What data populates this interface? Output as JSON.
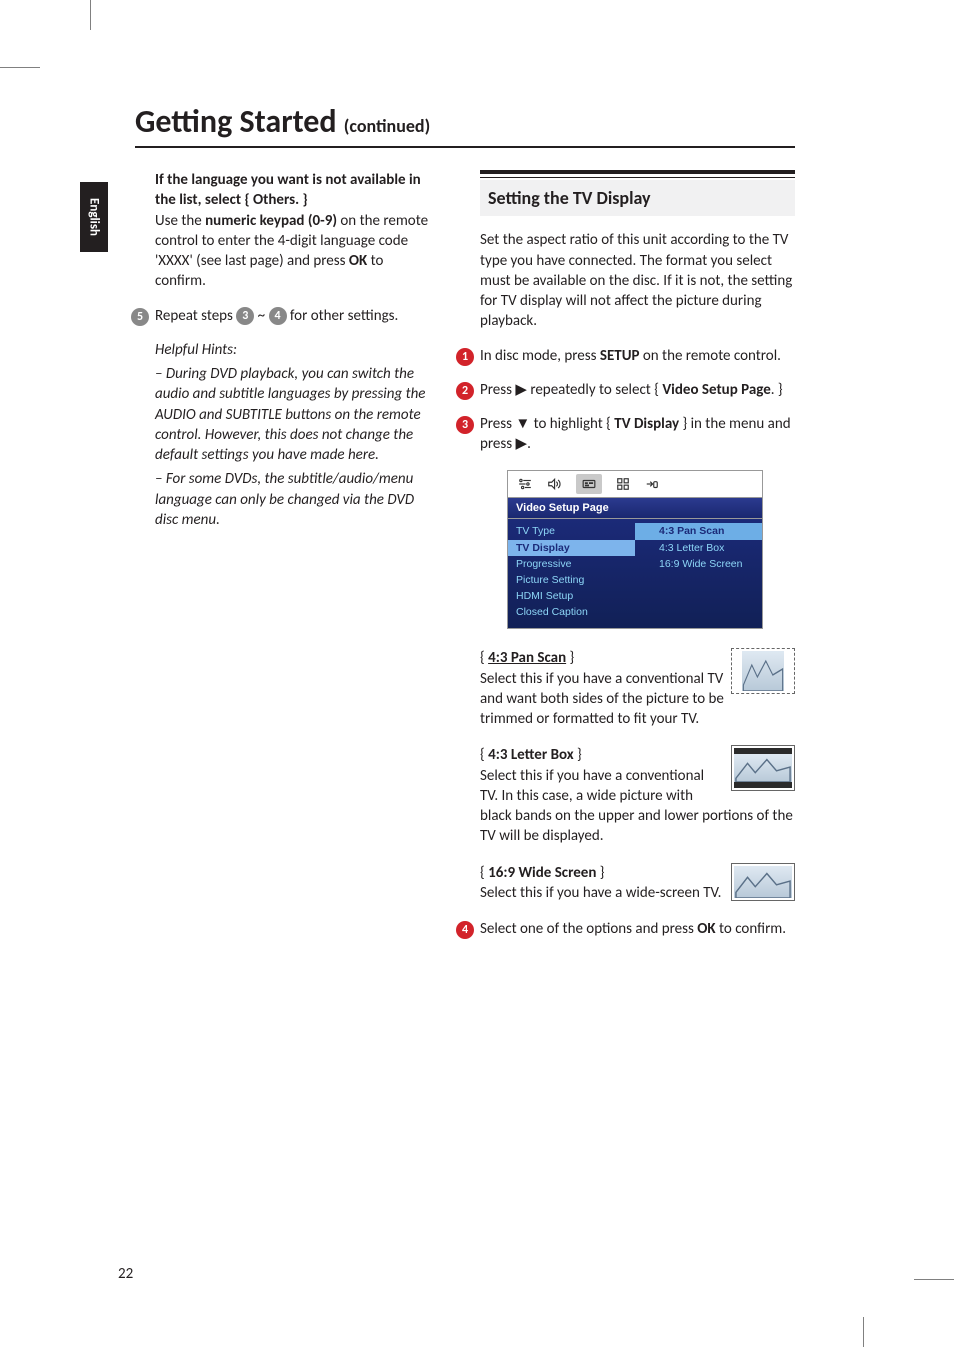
{
  "page": {
    "title": "Getting Started",
    "title_suffix": "(continued)",
    "language_tab": "English",
    "page_number": "22"
  },
  "left": {
    "bold_intro_1": "If the language you want is not available in the list, select { Others. }",
    "intro_2a": "Use the ",
    "intro_2b": "numeric keypad (0-9)",
    "intro_2c": " on the remote control to enter the 4-digit language code 'XXXX' (see last page) and press ",
    "intro_2d": "OK",
    "intro_2e": " to confirm.",
    "step5_badge": "5",
    "step5_a": "Repeat steps ",
    "step5_b": "3",
    "step5_c": " ~ ",
    "step5_d": "4",
    "step5_e": " for other settings.",
    "hints_title": "Helpful Hints:",
    "hint1": "– During DVD playback, you can switch the audio and subtitle languages by pressing the AUDIO and SUBTITLE buttons on the remote control.  However, this does not change the default settings you have made here.",
    "hint2": "– For some DVDs, the subtitle/audio/menu language can only be changed via the DVD disc menu."
  },
  "right": {
    "section_title": "Setting the TV Display",
    "intro": "Set the aspect ratio of this unit according to the TV type you have connected. The format you select must be available on the disc.  If it is not, the setting for TV display will not affect the picture during playback.",
    "step1_badge": "1",
    "step1_a": "In disc mode, press ",
    "step1_b": "SETUP",
    "step1_c": " on the remote control.",
    "step2_badge": "2",
    "step2_a": "Press ",
    "step2_b": " repeatedly to select { ",
    "step2_c": "Video Setup Page",
    "step2_d": ". }",
    "step3_badge": "3",
    "step3_a": "Press ",
    "step3_b": " to highlight { ",
    "step3_c": "TV Display",
    "step3_d": " } in the menu and press ",
    "step3_e": ".",
    "menu": {
      "title": "Video Setup Page",
      "left_items": [
        "TV Type",
        "TV Display",
        "Progressive",
        "Picture Setting",
        "HDMI Setup",
        "Closed Caption"
      ],
      "left_selected_index": 1,
      "right_items": [
        "4:3 Pan Scan",
        "4:3 Letter Box",
        "16:9 Wide Screen"
      ],
      "right_selected_index": 0
    },
    "opt1_label": "4:3 Pan Scan",
    "opt1_body": "Select this if you have a conventional TV and want both sides of the picture to be trimmed or formatted to fit your TV.",
    "opt2_label": "4:3 Letter Box",
    "opt2_body": "Select this if you have a conventional TV.  In this case, a wide picture with black bands on the upper and lower portions of the TV will be displayed.",
    "opt3_label": "16:9 Wide Screen",
    "opt3_body": "Select this if you have a wide-screen TV.",
    "step4_badge": "4",
    "step4_a": "Select one of the options and press ",
    "step4_b": "OK",
    "step4_c": " to confirm."
  }
}
